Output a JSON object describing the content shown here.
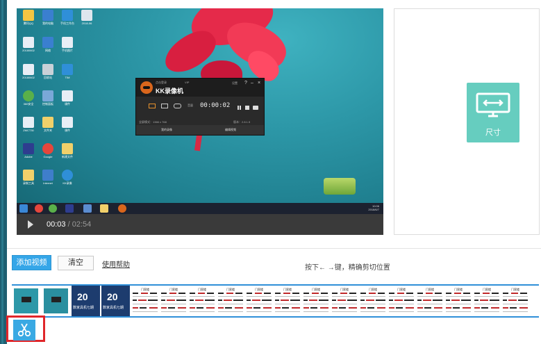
{
  "player": {
    "current_time": "00:03",
    "separator": " / ",
    "total_time": "02:54"
  },
  "recorder": {
    "brand": "KK录像机",
    "timer": "00:00:02",
    "account": "点击登录",
    "vip": "VIP",
    "settings": "设置",
    "mode_text": "全屏模式：1366 x 768",
    "version": "版本：2.8.1.5",
    "volume": "音量",
    "my_videos": "我的录像",
    "edit_video": "编辑视频"
  },
  "taskbar": {
    "time": "10:06",
    "date": "2018/6/7"
  },
  "size_panel": {
    "label": "尺寸"
  },
  "toolbar": {
    "add_video": "添加视频",
    "clear": "清空",
    "help": "使用帮助",
    "hint": "按下← →键，精确剪切位置"
  },
  "timeline": {
    "banner_text": "20",
    "banner_sub": "数家具机七期",
    "doc_title": "门家楼"
  },
  "colors": {
    "accent": "#35a6e8",
    "size_tile": "#66cdbf",
    "timeline_border": "#2f8fd8",
    "highlight": "#e0262a",
    "recorder_logo": "#d9661c"
  },
  "icons": {
    "play": "play-icon",
    "size": "monitor-resize-icon",
    "cut": "scissors-icon"
  }
}
